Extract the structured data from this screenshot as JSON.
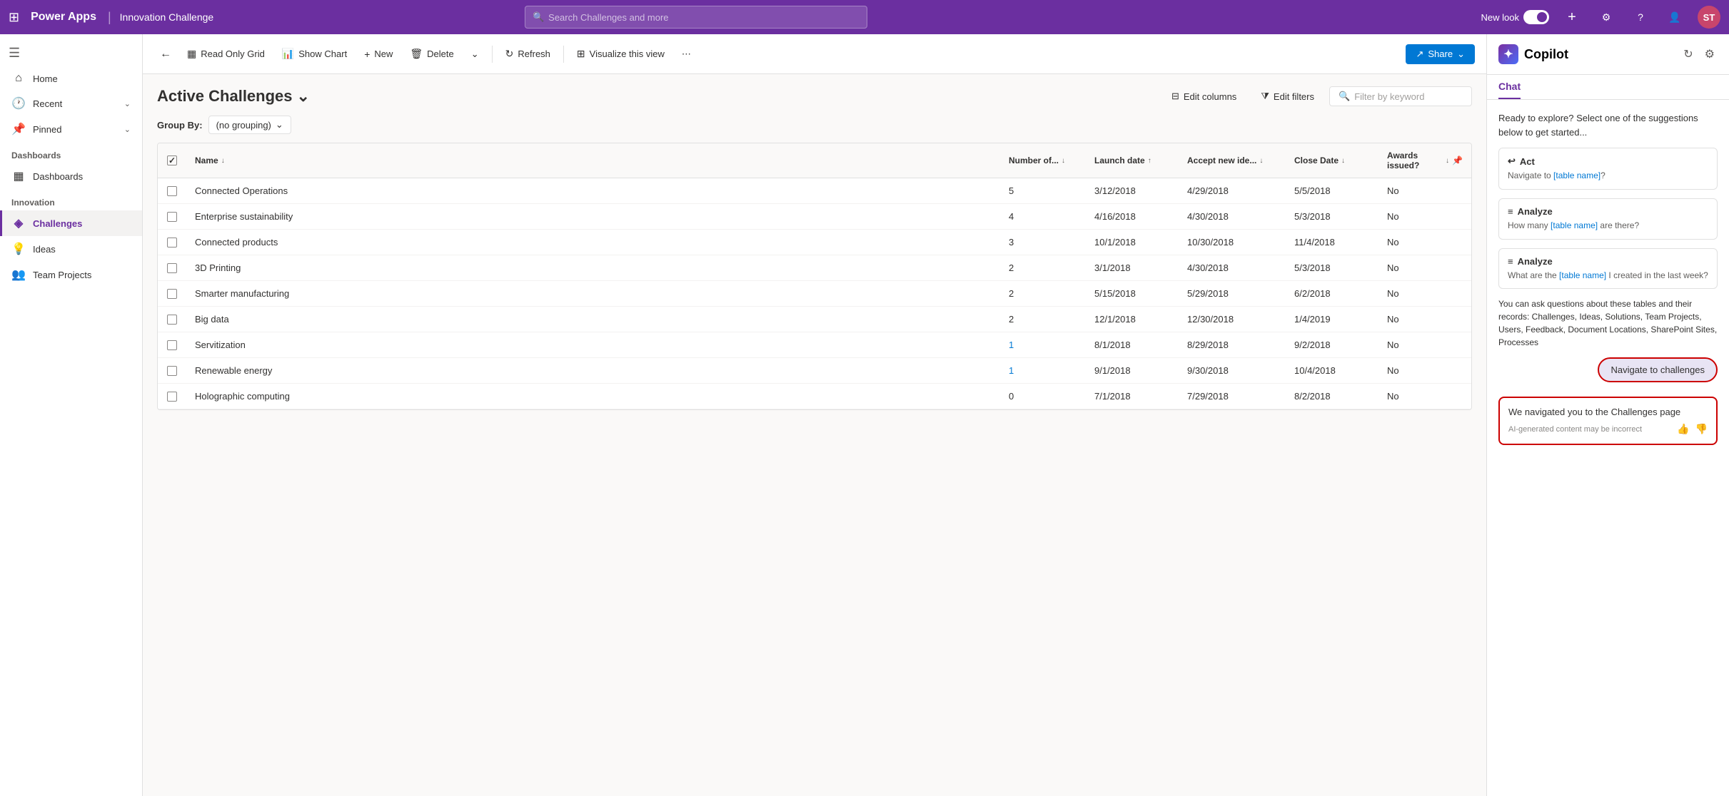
{
  "topNav": {
    "waffle": "⊞",
    "appName": "Power Apps",
    "separator": "|",
    "appContext": "Innovation Challenge",
    "searchPlaceholder": "Search Challenges and more",
    "newLookLabel": "New look",
    "avatarInitials": "ST"
  },
  "sidebar": {
    "hamburgerIcon": "☰",
    "items": [
      {
        "id": "home",
        "label": "Home",
        "icon": "⌂"
      },
      {
        "id": "recent",
        "label": "Recent",
        "icon": "🕐",
        "hasChevron": true
      },
      {
        "id": "pinned",
        "label": "Pinned",
        "icon": "📌",
        "hasChevron": true
      }
    ],
    "sections": [
      {
        "label": "Dashboards",
        "items": [
          {
            "id": "dashboards",
            "label": "Dashboards",
            "icon": "▦"
          }
        ]
      },
      {
        "label": "Innovation",
        "items": [
          {
            "id": "challenges",
            "label": "Challenges",
            "icon": "◈",
            "active": true
          },
          {
            "id": "ideas",
            "label": "Ideas",
            "icon": "💡"
          },
          {
            "id": "team-projects",
            "label": "Team Projects",
            "icon": "👥"
          }
        ]
      }
    ]
  },
  "commandBar": {
    "backIcon": "←",
    "buttons": [
      {
        "id": "read-only-grid",
        "icon": "▦",
        "label": "Read Only Grid"
      },
      {
        "id": "show-chart",
        "icon": "📊",
        "label": "Show Chart"
      },
      {
        "id": "new",
        "icon": "+",
        "label": "New"
      },
      {
        "id": "delete",
        "icon": "🗑",
        "label": "Delete"
      },
      {
        "id": "more",
        "icon": "⌄",
        "label": ""
      },
      {
        "id": "refresh",
        "icon": "↻",
        "label": "Refresh"
      },
      {
        "id": "visualize",
        "icon": "⊞",
        "label": "Visualize this view"
      },
      {
        "id": "ellipsis",
        "icon": "⋯",
        "label": ""
      }
    ],
    "shareLabel": "Share",
    "shareIcon": "↗"
  },
  "grid": {
    "viewTitle": "Active Challenges",
    "viewChevron": "⌄",
    "groupByLabel": "Group By:",
    "groupByValue": "(no grouping)",
    "editColumnsLabel": "Edit columns",
    "editFiltersLabel": "Edit filters",
    "filterPlaceholder": "Filter by keyword",
    "columns": [
      {
        "id": "name",
        "label": "Name",
        "sortIcon": "↓"
      },
      {
        "id": "number",
        "label": "Number of...",
        "sortIcon": "↓"
      },
      {
        "id": "launch",
        "label": "Launch date",
        "sortIcon": "↑"
      },
      {
        "id": "accept",
        "label": "Accept new ide...",
        "sortIcon": "↓"
      },
      {
        "id": "close",
        "label": "Close Date",
        "sortIcon": "↓"
      },
      {
        "id": "awards",
        "label": "Awards issued?",
        "sortIcon": "↓"
      }
    ],
    "rows": [
      {
        "name": "Connected Operations",
        "number": "5",
        "launch": "3/12/2018",
        "accept": "4/29/2018",
        "close": "5/5/2018",
        "awards": "No",
        "numberIsLink": false
      },
      {
        "name": "Enterprise sustainability",
        "number": "4",
        "launch": "4/16/2018",
        "accept": "4/30/2018",
        "close": "5/3/2018",
        "awards": "No",
        "numberIsLink": false
      },
      {
        "name": "Connected products",
        "number": "3",
        "launch": "10/1/2018",
        "accept": "10/30/2018",
        "close": "11/4/2018",
        "awards": "No",
        "numberIsLink": false
      },
      {
        "name": "3D Printing",
        "number": "2",
        "launch": "3/1/2018",
        "accept": "4/30/2018",
        "close": "5/3/2018",
        "awards": "No",
        "numberIsLink": false
      },
      {
        "name": "Smarter manufacturing",
        "number": "2",
        "launch": "5/15/2018",
        "accept": "5/29/2018",
        "close": "6/2/2018",
        "awards": "No",
        "numberIsLink": false
      },
      {
        "name": "Big data",
        "number": "2",
        "launch": "12/1/2018",
        "accept": "12/30/2018",
        "close": "1/4/2019",
        "awards": "No",
        "numberIsLink": false
      },
      {
        "name": "Servitization",
        "number": "1",
        "launch": "8/1/2018",
        "accept": "8/29/2018",
        "close": "9/2/2018",
        "awards": "No",
        "numberIsLink": true
      },
      {
        "name": "Renewable energy",
        "number": "1",
        "launch": "9/1/2018",
        "accept": "9/30/2018",
        "close": "10/4/2018",
        "awards": "No",
        "numberIsLink": true
      },
      {
        "name": "Holographic computing",
        "number": "0",
        "launch": "7/1/2018",
        "accept": "7/29/2018",
        "close": "8/2/2018",
        "awards": "No",
        "numberIsLink": false
      }
    ]
  },
  "copilot": {
    "title": "Copilot",
    "logoIcon": "✦",
    "tabs": [
      {
        "id": "chat",
        "label": "Chat",
        "active": true
      }
    ],
    "introText": "Ready to explore? Select one of the suggestions below to get started...",
    "suggestions": [
      {
        "id": "act",
        "icon": "↩",
        "title": "Act",
        "text": "Navigate to [table name]?"
      },
      {
        "id": "analyze1",
        "icon": "≡",
        "title": "Analyze",
        "text": "How many [table name] are there?"
      },
      {
        "id": "analyze2",
        "icon": "≡",
        "title": "Analyze",
        "text": "What are the [table name] I created in the last week?"
      }
    ],
    "tablesNoteText": "You can ask questions about these tables and their records: Challenges, Ideas, Solutions, Team Projects, Users, Feedback, Document Locations, SharePoint Sites, Processes",
    "userBubbleText": "Navigate to challenges",
    "assistantResponseText": "We navigated you to the Challenges page",
    "aiDisclaimer": "AI-generated content may be incorrect",
    "thumbUpIcon": "👍",
    "thumbDownIcon": "👎",
    "refreshIcon": "↻",
    "settingsIcon": "⚙"
  }
}
